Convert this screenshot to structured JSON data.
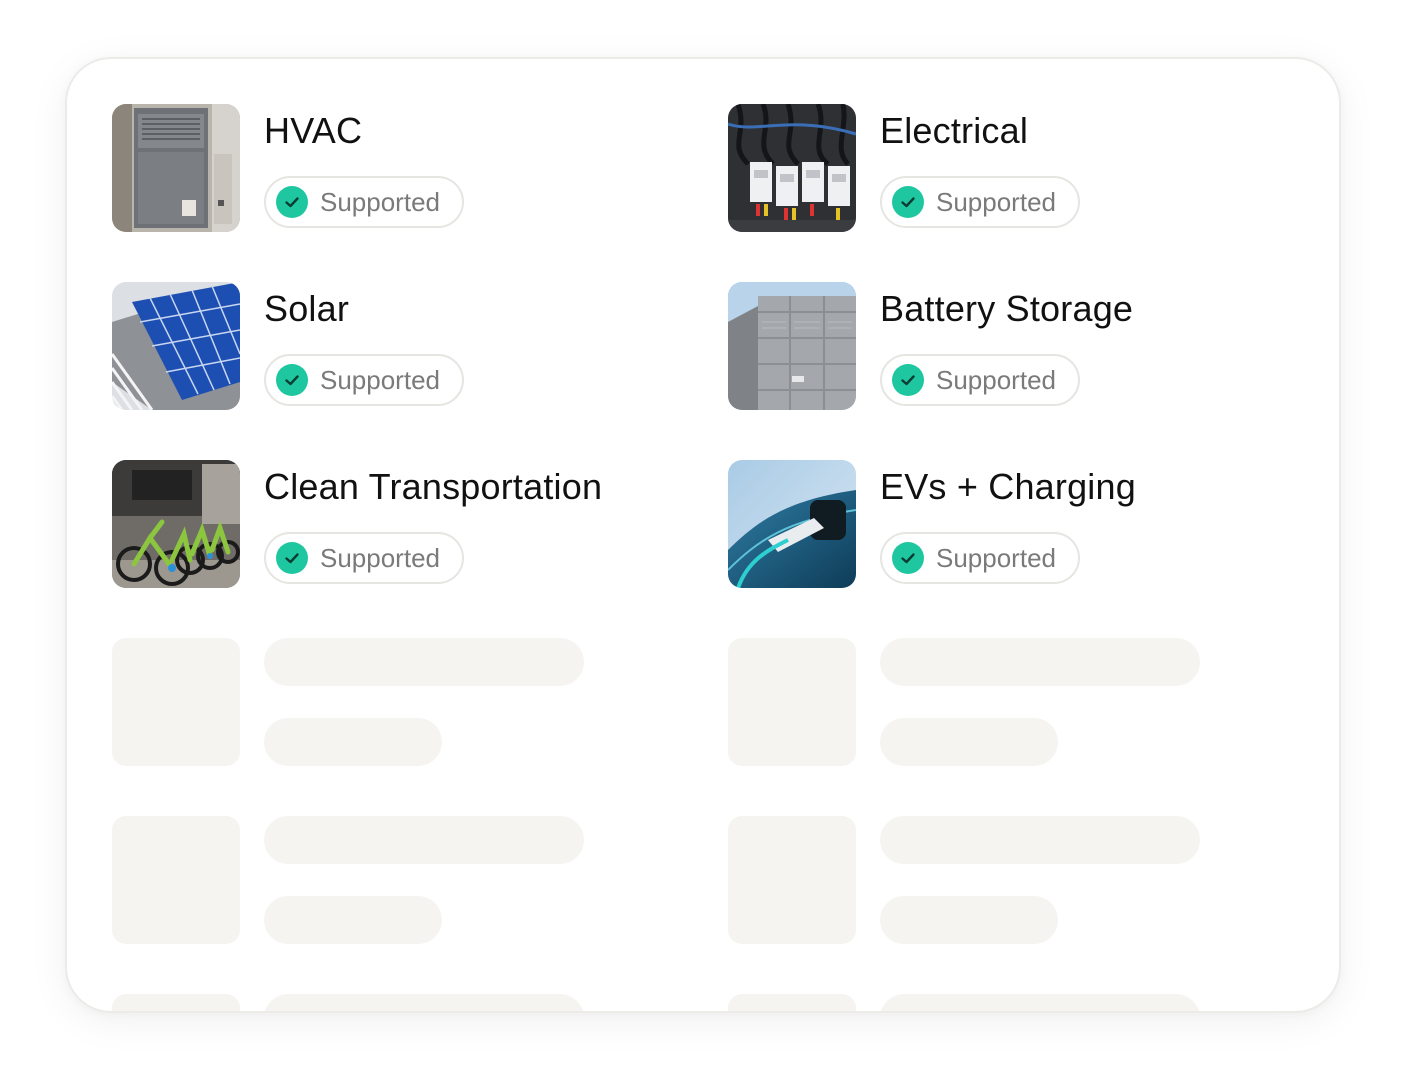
{
  "categories": [
    {
      "title": "HVAC",
      "status": "Supported",
      "image": "hvac-furnace-photo"
    },
    {
      "title": "Electrical",
      "status": "Supported",
      "image": "electrical-panel-photo"
    },
    {
      "title": "Solar",
      "status": "Supported",
      "image": "solar-panels-roof-photo"
    },
    {
      "title": "Battery Storage",
      "status": "Supported",
      "image": "battery-container-photo"
    },
    {
      "title": "Clean Transportation",
      "status": "Supported",
      "image": "bike-share-photo"
    },
    {
      "title": "EVs + Charging",
      "status": "Supported",
      "image": "ev-charger-photo"
    }
  ],
  "icons": {
    "status": "check-circle-icon"
  },
  "colors": {
    "accent": "#1fc7a1",
    "skeleton": "#f5f4f0",
    "badge_text": "#7a7a7a"
  }
}
